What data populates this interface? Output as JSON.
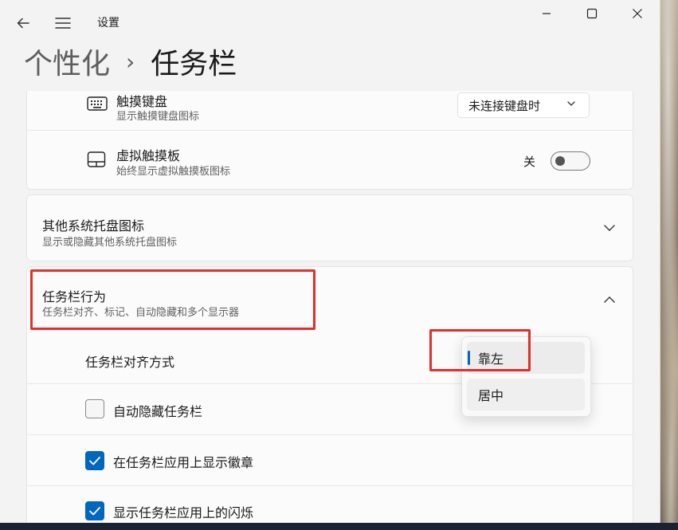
{
  "app": {
    "title": "设置",
    "back_icon": "back-arrow-icon",
    "menu_icon": "hamburger-menu-icon"
  },
  "window_controls": [
    "minimize-icon",
    "maximize-icon",
    "close-icon"
  ],
  "breadcrumb": {
    "parent": "个性化",
    "separator": "›",
    "current": "任务栏"
  },
  "settings": {
    "touch_keyboard": {
      "title": "触摸键盘",
      "subtitle": "显示触摸键盘图标",
      "icon": "keyboard-icon",
      "dropdown_value": "未连接键盘时"
    },
    "virtual_touchpad": {
      "title": "虚拟触摸板",
      "subtitle": "始终显示虚拟触摸板图标",
      "icon": "touchpad-icon",
      "toggle_label": "关",
      "toggle_on": false
    },
    "other_tray_icons": {
      "title": "其他系统托盘图标",
      "subtitle": "显示或隐藏其他系统托盘图标",
      "expanded": false
    },
    "taskbar_behaviors": {
      "title": "任务栏行为",
      "subtitle": "任务栏对齐、标记、自动隐藏和多个显示器",
      "expanded": true,
      "alignment": {
        "label": "任务栏对齐方式",
        "options": [
          "靠左",
          "居中"
        ],
        "selected": "靠左"
      },
      "checkboxes": [
        {
          "label": "自动隐藏任务栏",
          "checked": false
        },
        {
          "label": "在任务栏应用上显示徽章",
          "checked": true
        },
        {
          "label": "显示任务栏应用上的闪烁",
          "checked": true
        }
      ]
    }
  },
  "colors": {
    "accent": "#0067c0",
    "annotation": "#e0302a"
  }
}
